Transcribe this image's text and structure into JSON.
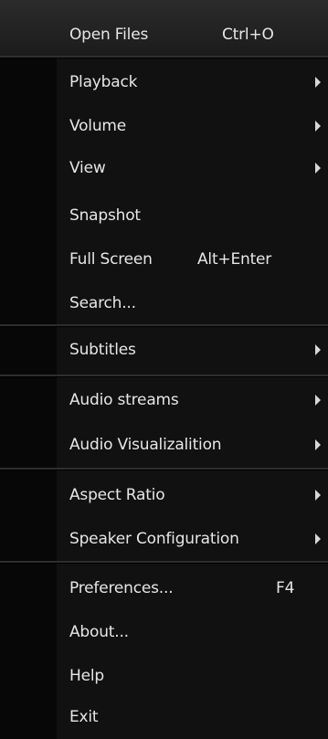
{
  "menu": {
    "items": [
      {
        "label": "Open Files",
        "shortcut": "Ctrl+O",
        "submenu": false
      },
      {
        "label": "Playback",
        "shortcut": "",
        "submenu": true
      },
      {
        "label": "Volume",
        "shortcut": "",
        "submenu": true
      },
      {
        "label": "View",
        "shortcut": "",
        "submenu": true
      },
      {
        "label": "Snapshot",
        "shortcut": "",
        "submenu": false
      },
      {
        "label": "Full Screen",
        "shortcut": "Alt+Enter",
        "submenu": false
      },
      {
        "label": "Search...",
        "shortcut": "",
        "submenu": false
      },
      {
        "label": "Subtitles",
        "shortcut": "",
        "submenu": true
      },
      {
        "label": "Audio streams",
        "shortcut": "",
        "submenu": true
      },
      {
        "label": "Audio Visualizalition",
        "shortcut": "",
        "submenu": true
      },
      {
        "label": "Aspect Ratio",
        "shortcut": "",
        "submenu": true
      },
      {
        "label": "Speaker Configuration",
        "shortcut": "",
        "submenu": true
      },
      {
        "label": "Preferences...",
        "shortcut": "F4",
        "submenu": false
      },
      {
        "label": "About...",
        "shortcut": "",
        "submenu": false
      },
      {
        "label": "Help",
        "shortcut": "",
        "submenu": false
      },
      {
        "label": "Exit",
        "shortcut": "",
        "submenu": false
      }
    ]
  },
  "colors": {
    "background": "#111111",
    "gutter": "#070707",
    "text": "#e6e6e6",
    "separator": "#2e2e2e"
  }
}
